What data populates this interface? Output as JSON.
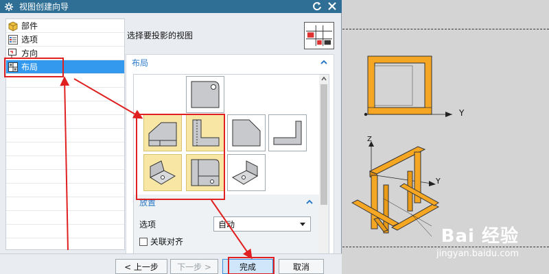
{
  "dialog": {
    "title": "视图创建向导"
  },
  "nav": {
    "items": [
      {
        "label": "部件",
        "icon": "part-icon"
      },
      {
        "label": "选项",
        "icon": "options-icon"
      },
      {
        "label": "方向",
        "icon": "orientation-icon"
      },
      {
        "label": "布局",
        "icon": "layout-icon",
        "selected": true
      }
    ]
  },
  "prompt": {
    "label": "选择要投影的视图"
  },
  "layout_panel": {
    "title": "布局"
  },
  "placement": {
    "title": "放置",
    "option_label": "选项",
    "option_value": "自动",
    "checkbox_label": "关联对齐"
  },
  "footer": {
    "back_label": "< 上一步",
    "next_label": "下一步 >",
    "finish_label": "完成",
    "cancel_label": "取消"
  },
  "canvas": {
    "axis_y_top": "Y",
    "axis_z": "Z",
    "axis_y_iso": "Y"
  },
  "watermark": {
    "main": "Bai 经验",
    "sub": "jingyan.baidu.com"
  },
  "colors": {
    "titlebar": "#2f6f96",
    "selected": "#3399ee",
    "highlight": "#f8e7a4",
    "annotation": "#e02020",
    "model": "#f5a623"
  }
}
